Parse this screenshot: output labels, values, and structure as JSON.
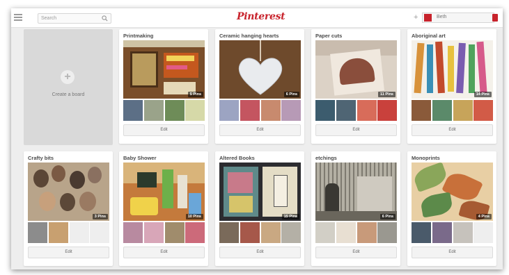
{
  "header": {
    "search_placeholder": "Search",
    "logo": "Pinterest",
    "username": "Beth"
  },
  "create_board": {
    "label": "Create a board"
  },
  "boards": [
    {
      "title": "Printmaking",
      "pins": "5 Pins",
      "edit": "Edit"
    },
    {
      "title": "Ceramic hanging hearts",
      "pins": "6 Pins",
      "edit": "Edit"
    },
    {
      "title": "Paper cuts",
      "pins": "11 Pins",
      "edit": "Edit"
    },
    {
      "title": "Aboriginal art",
      "pins": "14 Pins",
      "edit": "Edit"
    },
    {
      "title": "Crafty bits",
      "pins": "3 Pins",
      "edit": "Edit"
    },
    {
      "title": "Baby Shower",
      "pins": "10 Pins",
      "edit": "Edit"
    },
    {
      "title": "Altered Books",
      "pins": "15 Pins",
      "edit": "Edit"
    },
    {
      "title": "etchings",
      "pins": "6 Pins",
      "edit": "Edit"
    },
    {
      "title": "Monoprints",
      "pins": "4 Pins",
      "edit": "Edit"
    }
  ],
  "colors": {
    "brand": "#c8232c",
    "background": "#eeeeee",
    "create_board_bg": "#d9d9d9"
  },
  "icons": [
    "menu-icon",
    "search-icon",
    "plus-icon",
    "notification-icon"
  ]
}
